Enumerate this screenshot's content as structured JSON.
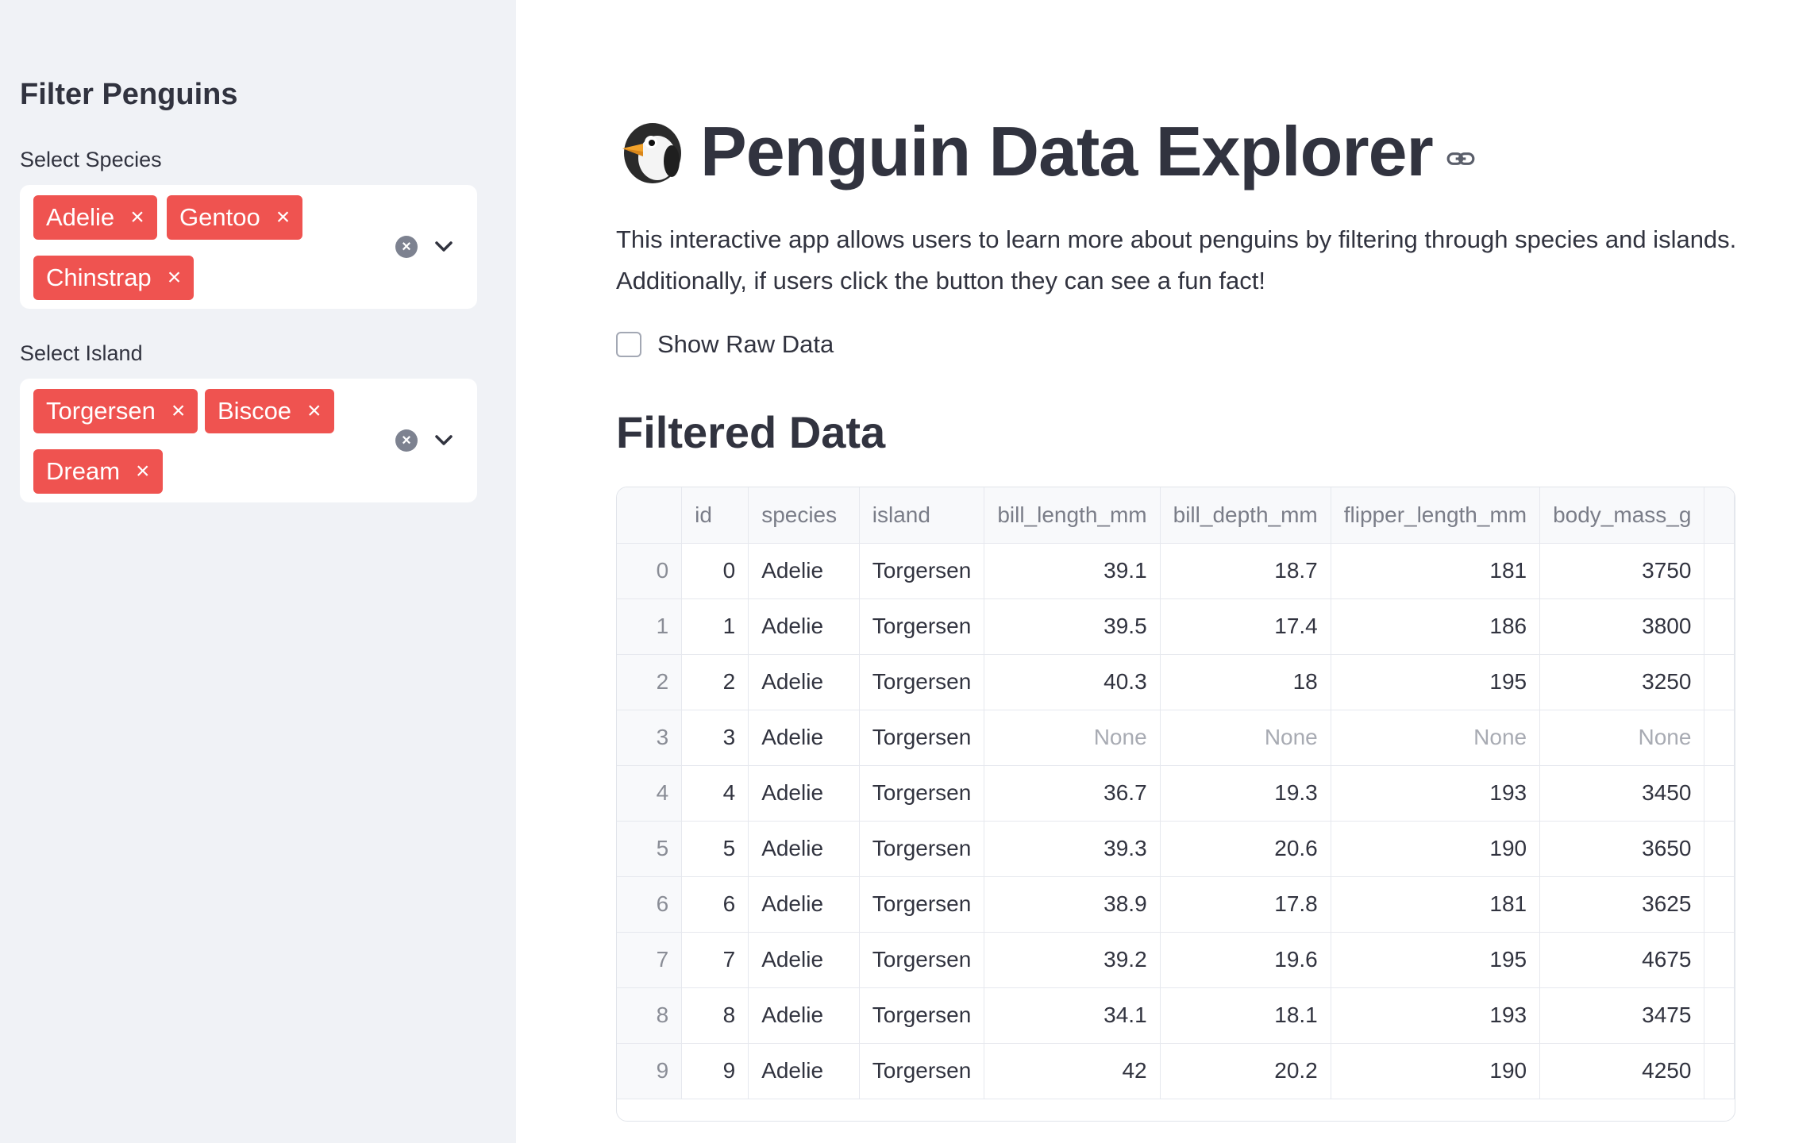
{
  "sidebar": {
    "title": "Filter Penguins",
    "species": {
      "label": "Select Species",
      "chips": [
        "Adelie",
        "Gentoo",
        "Chinstrap"
      ]
    },
    "island": {
      "label": "Select Island",
      "chips": [
        "Torgersen",
        "Biscoe",
        "Dream"
      ]
    },
    "remove_glyph": "×"
  },
  "main": {
    "icon": "penguin-emoji-icon",
    "title": "Penguin Data Explorer",
    "description_line1": "This interactive app allows users to learn more about penguins by filtering through species and islands.",
    "description_line2": "Additionally, if users click the button they can see a fun fact!",
    "checkbox_label": "Show Raw Data",
    "checkbox_checked": false,
    "section_title": "Filtered Data"
  },
  "table": {
    "columns": [
      "",
      "id",
      "species",
      "island",
      "bill_length_mm",
      "bill_depth_mm",
      "flipper_length_mm",
      "body_mass_g"
    ],
    "rows": [
      [
        "0",
        "0",
        "Adelie",
        "Torgersen",
        "39.1",
        "18.7",
        "181",
        "3750"
      ],
      [
        "1",
        "1",
        "Adelie",
        "Torgersen",
        "39.5",
        "17.4",
        "186",
        "3800"
      ],
      [
        "2",
        "2",
        "Adelie",
        "Torgersen",
        "40.3",
        "18",
        "195",
        "3250"
      ],
      [
        "3",
        "3",
        "Adelie",
        "Torgersen",
        "None",
        "None",
        "None",
        "None"
      ],
      [
        "4",
        "4",
        "Adelie",
        "Torgersen",
        "36.7",
        "19.3",
        "193",
        "3450"
      ],
      [
        "5",
        "5",
        "Adelie",
        "Torgersen",
        "39.3",
        "20.6",
        "190",
        "3650"
      ],
      [
        "6",
        "6",
        "Adelie",
        "Torgersen",
        "38.9",
        "17.8",
        "181",
        "3625"
      ],
      [
        "7",
        "7",
        "Adelie",
        "Torgersen",
        "39.2",
        "19.6",
        "195",
        "4675"
      ],
      [
        "8",
        "8",
        "Adelie",
        "Torgersen",
        "34.1",
        "18.1",
        "193",
        "3475"
      ],
      [
        "9",
        "9",
        "Adelie",
        "Torgersen",
        "42",
        "20.2",
        "190",
        "4250"
      ]
    ]
  },
  "colors": {
    "chip": "#ef5350",
    "sidebar_bg": "#f0f2f6",
    "text": "#31333f"
  }
}
